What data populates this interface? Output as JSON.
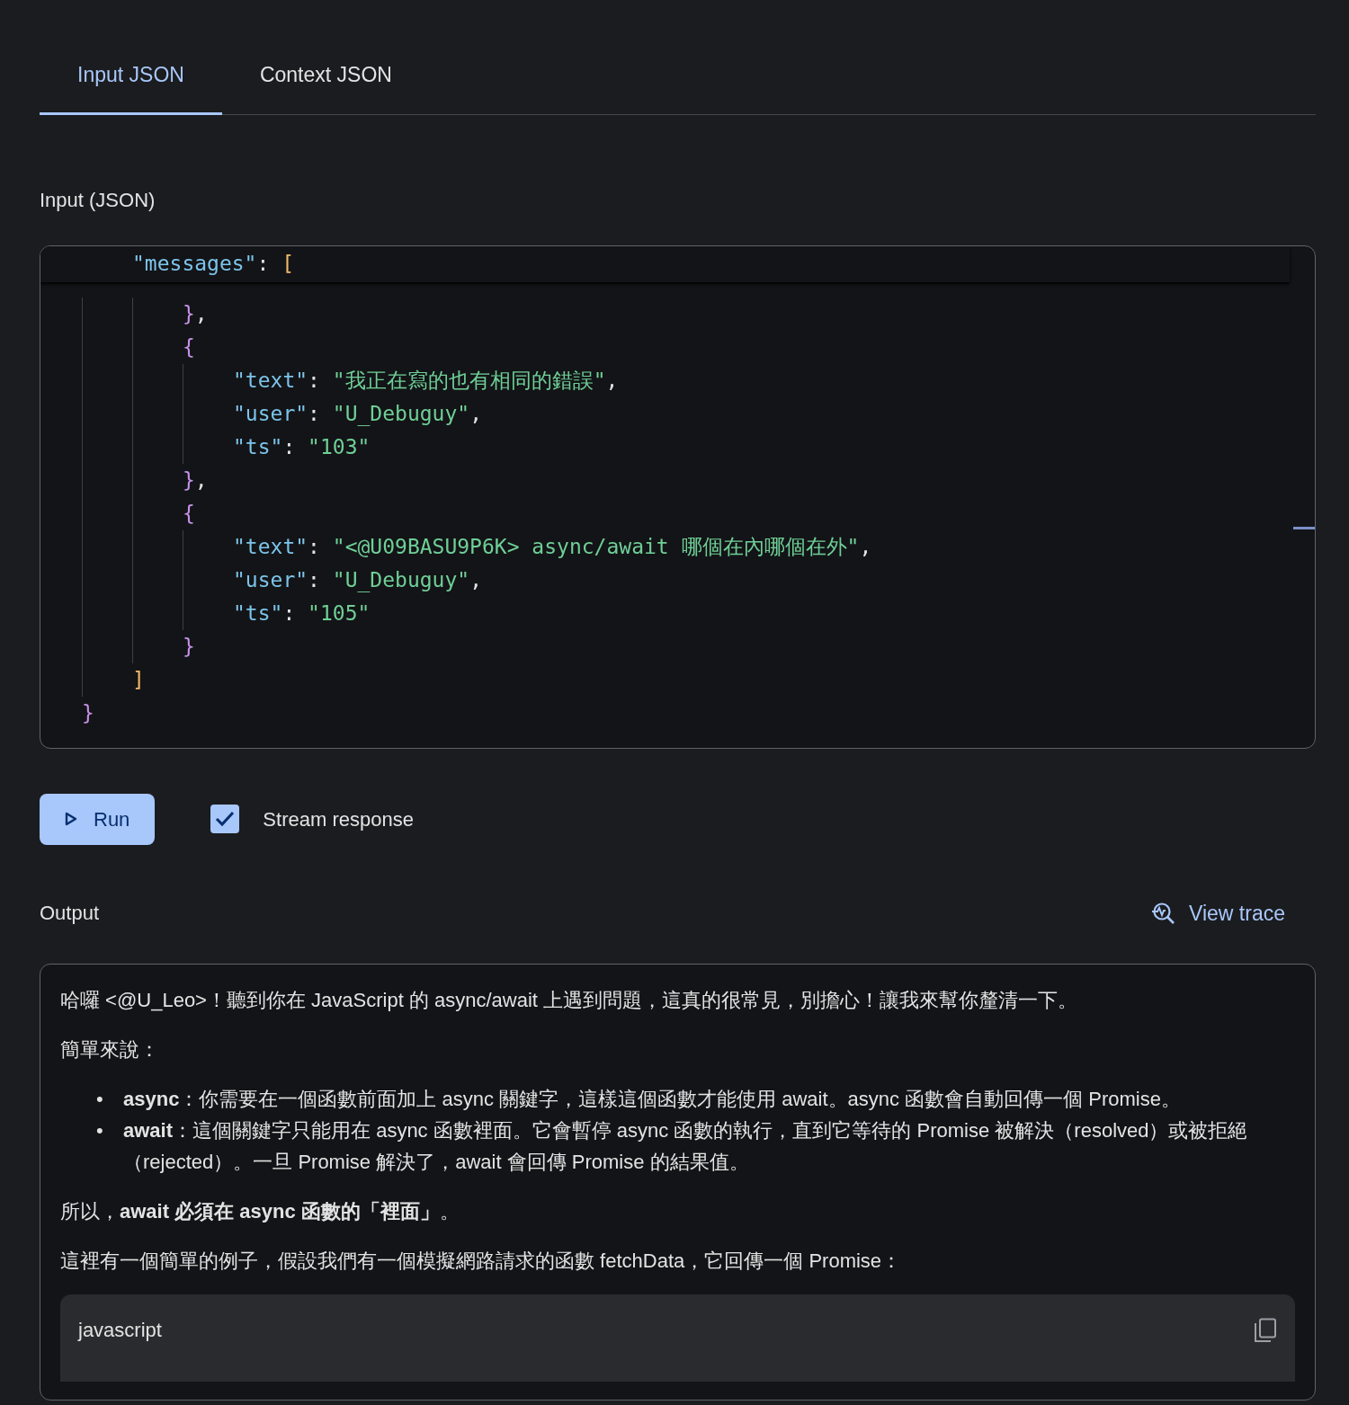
{
  "tabs": [
    {
      "label": "Input JSON",
      "selected": true
    },
    {
      "label": "Context JSON",
      "selected": false
    }
  ],
  "input": {
    "label": "Input (JSON)",
    "sticky_line": [
      {
        "kind": "key",
        "text": "    \"messages\""
      },
      {
        "kind": "punct",
        "text": ": "
      },
      {
        "kind": "bracket",
        "text": "["
      }
    ],
    "lines": [
      [
        {
          "kind": "brace",
          "text": "        }"
        },
        {
          "kind": "punct",
          "text": ","
        }
      ],
      [
        {
          "kind": "brace",
          "text": "        {"
        }
      ],
      [
        {
          "kind": "key",
          "text": "            \"text\""
        },
        {
          "kind": "punct",
          "text": ": "
        },
        {
          "kind": "string",
          "text": "\"我正在寫的也有相同的錯誤\""
        },
        {
          "kind": "punct",
          "text": ","
        }
      ],
      [
        {
          "kind": "key",
          "text": "            \"user\""
        },
        {
          "kind": "punct",
          "text": ": "
        },
        {
          "kind": "string",
          "text": "\"U_Debuguy\""
        },
        {
          "kind": "punct",
          "text": ","
        }
      ],
      [
        {
          "kind": "key",
          "text": "            \"ts\""
        },
        {
          "kind": "punct",
          "text": ": "
        },
        {
          "kind": "string",
          "text": "\"103\""
        }
      ],
      [
        {
          "kind": "brace",
          "text": "        }"
        },
        {
          "kind": "punct",
          "text": ","
        }
      ],
      [
        {
          "kind": "brace",
          "text": "        {"
        }
      ],
      [
        {
          "kind": "key",
          "text": "            \"text\""
        },
        {
          "kind": "punct",
          "text": ": "
        },
        {
          "kind": "string",
          "text": "\"<@U09BASU9P6K> async/await 哪個在內哪個在外\""
        },
        {
          "kind": "punct",
          "text": ","
        }
      ],
      [
        {
          "kind": "key",
          "text": "            \"user\""
        },
        {
          "kind": "punct",
          "text": ": "
        },
        {
          "kind": "string",
          "text": "\"U_Debuguy\""
        },
        {
          "kind": "punct",
          "text": ","
        }
      ],
      [
        {
          "kind": "key",
          "text": "            \"ts\""
        },
        {
          "kind": "punct",
          "text": ": "
        },
        {
          "kind": "string",
          "text": "\"105\""
        }
      ],
      [
        {
          "kind": "brace",
          "text": "        }"
        }
      ],
      [
        {
          "kind": "bracket",
          "text": "    ]"
        }
      ],
      [
        {
          "kind": "brace",
          "text": "}"
        }
      ]
    ]
  },
  "run_button": "Run",
  "stream_response": {
    "label": "Stream response",
    "checked": true
  },
  "output": {
    "label": "Output",
    "view_trace": "View trace",
    "blocks": [
      {
        "kind": "paragraph",
        "text": "哈囉 <@U_Leo>！聽到你在 JavaScript 的 async/await 上遇到問題，這真的很常見，別擔心！讓我來幫你釐清一下。"
      },
      {
        "kind": "paragraph",
        "text": "簡單來說："
      },
      {
        "kind": "list",
        "items": [
          {
            "marker": "•",
            "text": "**async**：你需要在一個函數前面加上 async 關鍵字，這樣這個函數才能使用 await。async 函數會自動回傳一個 Promise。"
          },
          {
            "marker": "•",
            "text": "**await**：這個關鍵字只能用在 async 函數裡面。它會暫停 async 函數的執行，直到它等待的 Promise 被解決（resolved）或被拒絕（rejected）。一旦 Promise 解決了，await 會回傳 Promise 的結果值。"
          }
        ]
      },
      {
        "kind": "paragraph",
        "text": "所以，**await 必須在 async 函數的「裡面」**。"
      },
      {
        "kind": "paragraph",
        "text": "這裡有一個簡單的例子，假設我們有一個模擬網路請求的函數 fetchData，它回傳一個 Promise："
      },
      {
        "kind": "code",
        "language": "javascript"
      }
    ]
  }
}
